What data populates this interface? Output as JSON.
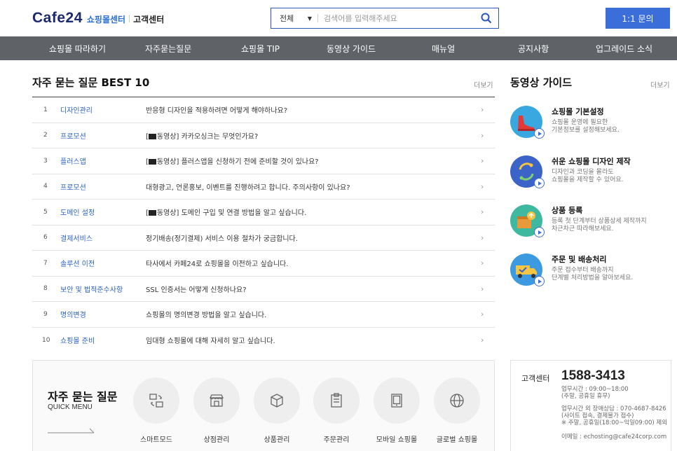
{
  "header": {
    "logo": "Cafe24",
    "logo_sub": "쇼핑몰센터",
    "logo_sub2": "고객센터",
    "search_select": "전체",
    "search_placeholder": "검색어를 입력해주세요",
    "ask_button": "1:1 문의"
  },
  "nav": [
    {
      "label": "쇼핑몰 따라하기"
    },
    {
      "label": "자주묻는질문"
    },
    {
      "label": "쇼핑몰 TIP"
    },
    {
      "label": "동영상 가이드"
    },
    {
      "label": "매뉴얼"
    },
    {
      "label": "공지사항"
    },
    {
      "label": "업그레이드 소식"
    }
  ],
  "faq": {
    "title": "자주 묻는 질문 BEST 10",
    "more": "더보기",
    "items": [
      {
        "num": "1",
        "cat": "디자인관리",
        "prefix": "",
        "q": "반응형 디자인을 적용하려면 어떻게 해야하나요?"
      },
      {
        "num": "2",
        "cat": "프로모션",
        "prefix": "동영상]",
        "q": " 카카오싱크는 무엇인가요?"
      },
      {
        "num": "3",
        "cat": "플러스앱",
        "prefix": "동영상]",
        "q": " 플러스앱을 신청하기 전에 준비할 것이 있나요?"
      },
      {
        "num": "4",
        "cat": "프로모션",
        "prefix": "",
        "q": "대형광고, 언론홍보, 이벤트를 진행하려고 합니다. 주의사항이 있나요?"
      },
      {
        "num": "5",
        "cat": "도메인 설정",
        "prefix": "동영상]",
        "q": " 도메인 구입 및 연결 방법을 알고 싶습니다."
      },
      {
        "num": "6",
        "cat": "결제서비스",
        "prefix": "",
        "q": "정기배송(정기결제) 서비스 이용 절차가 궁금합니다."
      },
      {
        "num": "7",
        "cat": "솔루션 이전",
        "prefix": "",
        "q": "타사에서 카페24로 쇼핑몰을 이전하고 싶습니다."
      },
      {
        "num": "8",
        "cat": "보안 및 법적준수사항",
        "prefix": "",
        "q": "SSL 인증서는 어떻게 신청하나요?"
      },
      {
        "num": "9",
        "cat": "명의변경",
        "prefix": "",
        "q": "쇼핑몰의 명의변경 방법을 알고 싶습니다."
      },
      {
        "num": "10",
        "cat": "쇼핑몰 준비",
        "prefix": "",
        "q": "임대형 쇼핑몰에 대해 자세히 알고 싶습니다."
      }
    ]
  },
  "video_guide": {
    "title": "동영상 가이드",
    "more": "더보기",
    "items": [
      {
        "name": "쇼핑몰 기본설정",
        "desc1": "쇼핑몰 운영에 필요한",
        "desc2": "기본정보를 설정해보세요.",
        "color": "#3aa8e0"
      },
      {
        "name": "쉬운 쇼핑몰 디자인 제작",
        "desc1": "디자인과 코딩을 몰라도",
        "desc2": "쇼핑몰을 제작할 수 있어요.",
        "color": "#3b63c8"
      },
      {
        "name": "상품 등록",
        "desc1": "등록 첫 단계부터 상품상세 제작까지",
        "desc2": "차근차근 따라해보세요.",
        "color": "#3fb8a0"
      },
      {
        "name": "주문 및 배송처리",
        "desc1": "주문 접수부터 배송까지",
        "desc2": "단계별 처리방법을 알아보세요.",
        "color": "#3d9ae0"
      }
    ]
  },
  "quick_menu": {
    "title": "자주 묻는 질문",
    "sub": "QUICK MENU",
    "items": [
      {
        "label": "스마트모드",
        "icon": "smart-mode-icon"
      },
      {
        "label": "상점관리",
        "icon": "store-icon"
      },
      {
        "label": "상품관리",
        "icon": "box-icon"
      },
      {
        "label": "주문관리",
        "icon": "clipboard-icon"
      },
      {
        "label": "모바일 쇼핑몰",
        "icon": "tablet-icon"
      },
      {
        "label": "글로벌 쇼핑몰",
        "icon": "globe-icon"
      }
    ]
  },
  "customer_center": {
    "label": "고객센터",
    "phone": "1588-3413",
    "line1": "업무시간 : 09:00~18:00",
    "line2": "(주말, 공휴일 휴무)",
    "line3": "업무시간 외 장애상담 : 070-4687-8426",
    "line4": "(사이트 접속, 결제불가 접수)",
    "line5": "※ 주말, 공휴일(18:00~익일09:00) 제외",
    "line6": "이메일 : echosting@cafe24corp.com"
  }
}
